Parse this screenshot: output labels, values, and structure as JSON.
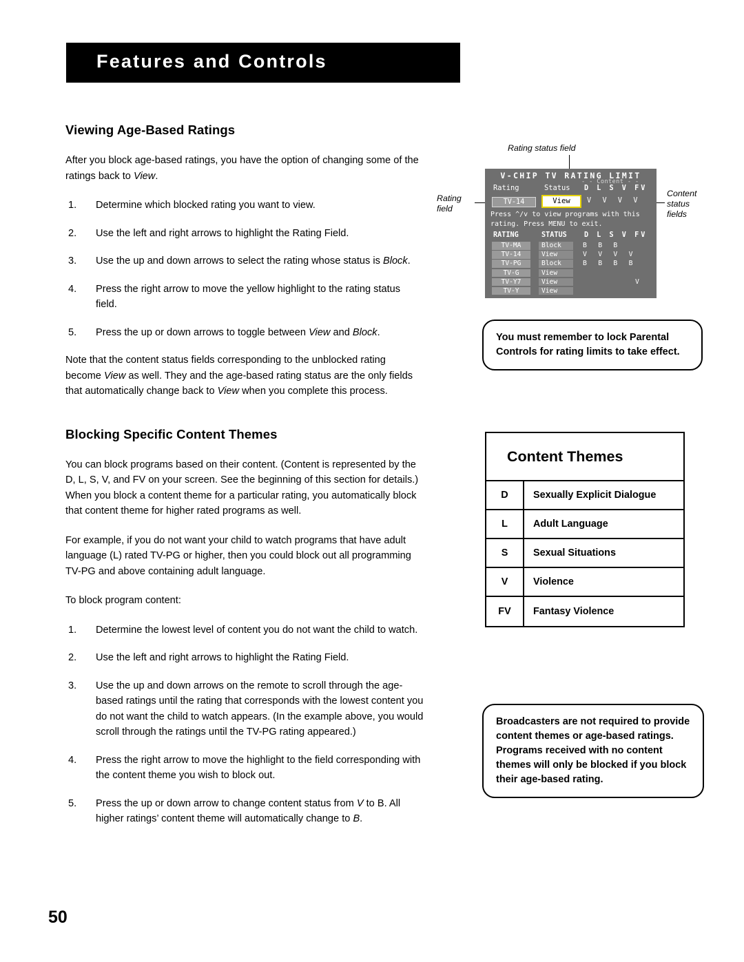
{
  "header": {
    "banner_title": "Features and Controls"
  },
  "page_number": "50",
  "left": {
    "heading1": "Viewing Age-Based Ratings",
    "intro1_a": "After you block age-based ratings, you have the option of changing some of the ratings back to ",
    "intro1_italic": "View",
    "intro1_b": ".",
    "steps1": [
      {
        "num": "1.",
        "text": "Determine which blocked rating you want to view."
      },
      {
        "num": "2.",
        "text": "Use the left and right arrows to highlight the Rating Field."
      },
      {
        "num": "3.",
        "text": "Use the up and down arrows to select the rating whose status is Block."
      },
      {
        "num": "4.",
        "text": "Press the right arrow to move the yellow highlight to the rating status field."
      },
      {
        "num": "5.",
        "text": "Press the up or down arrows to toggle between View and Block."
      }
    ],
    "note1": "Note that the content status fields corresponding to the unblocked rating become View as well. They and the age-based rating status are the only fields that automatically change back to View when you complete this process.",
    "heading2": "Blocking Specific Content Themes",
    "para2a": "You can block programs based on their content. (Content is represented by the D, L, S, V, and FV on your screen. See the beginning of this section for details.) When you block a content theme for a particular rating, you automatically block that content theme for higher rated programs as well.",
    "para2b": "For example, if you do not want your child to watch programs that have adult language (L) rated TV-PG or higher, then you could block out all programming TV-PG and above containing adult language.",
    "para2c": "To block program content:",
    "steps2": [
      {
        "num": "1.",
        "text": "Determine the lowest level of content you do not want the child to watch."
      },
      {
        "num": "2.",
        "text": "Use the left and right arrows to highlight the Rating Field."
      },
      {
        "num": "3.",
        "text": "Use the up and down arrows on the remote to scroll through the age-based ratings until the rating that corresponds with the lowest content you do not want the child to watch appears.  (In the example above, you would scroll through the ratings until the TV-PG rating appeared.)"
      },
      {
        "num": "4.",
        "text": "Press the right arrow to move the highlight to the field corresponding with the content theme you wish to block out."
      },
      {
        "num": "5.",
        "text": "Press the up or down arrow to change content status from V to B. All higher ratings’ content theme will automatically change to B."
      }
    ]
  },
  "callouts": {
    "rating_status_field": "Rating status field",
    "rating_field": "Rating\nfield",
    "rating_field_l1": "Rating",
    "rating_field_l2": "field",
    "content_status_l1": "Content",
    "content_status_l2": "status",
    "content_status_l3": "fields"
  },
  "osd": {
    "title": "V-CHIP TV RATING LIMIT",
    "header_rating": "Rating",
    "header_status": "Status",
    "content_label": "- - Content - -",
    "content_cols": "D L S V FV",
    "selected_rating": "TV-14",
    "selected_status": "View",
    "selected_values": "V V V V",
    "instructions": "Press ^/v to view programs with this rating. Press MENU to exit.",
    "table_header": {
      "rating": "RATING",
      "status": "STATUS",
      "content": "D L S V FV"
    },
    "rows": [
      {
        "rating": "TV-MA",
        "status": "Block",
        "values": "B B B"
      },
      {
        "rating": "TV-14",
        "status": "View",
        "values": "V V V V"
      },
      {
        "rating": "TV-PG",
        "status": "Block",
        "values": "B B B B"
      },
      {
        "rating": "TV-G",
        "status": "View",
        "values": ""
      },
      {
        "rating": "TV-Y7",
        "status": "View",
        "values": "V"
      },
      {
        "rating": "TV-Y",
        "status": "View",
        "values": ""
      }
    ]
  },
  "notes": {
    "note_lock": "You must remember to lock Parental Controls for rating limits to take effect.",
    "note_broadcasters": "Broadcasters are not required to provide content themes or age-based ratings. Programs received with no content themes will only be blocked if you block their age-based rating."
  },
  "content_themes": {
    "title": "Content Themes",
    "rows": [
      {
        "code": "D",
        "label": "Sexually Explicit Dialogue"
      },
      {
        "code": "L",
        "label": "Adult Language"
      },
      {
        "code": "S",
        "label": "Sexual Situations"
      },
      {
        "code": "V",
        "label": "Violence"
      },
      {
        "code": "FV",
        "label": "Fantasy Violence"
      }
    ]
  }
}
